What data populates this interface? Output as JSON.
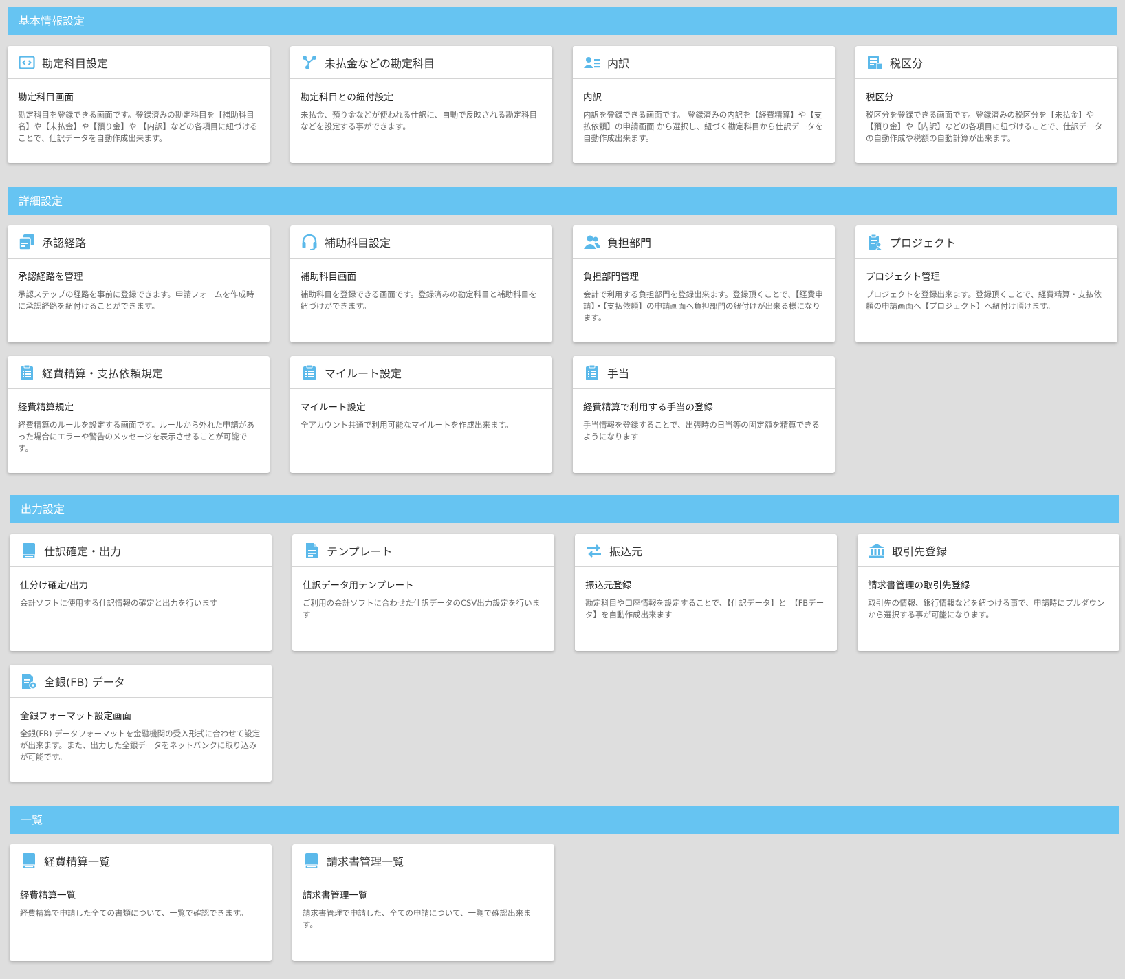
{
  "colors": {
    "accent": "#66c4f2",
    "icon": "#5bb9ea",
    "background": "#dedede"
  },
  "sections": [
    {
      "title": "基本情報設定",
      "cards": [
        {
          "icon": "code-icon",
          "title": "勘定科目設定",
          "subtitle": "勘定科目画面",
          "desc": "勘定科目を登録できる画面です。登録済みの勘定科目を【補助科目名】や【未払金】や【預り金】や 【内訳】などの各項目に紐づけることで、仕訳データを自動作成出来ます。"
        },
        {
          "icon": "link-icon",
          "title": "未払金などの勘定科目",
          "subtitle": "勘定科目との紐付設定",
          "desc": "未払金、預り金などが使われる仕訳に、自動で反映される勘定科目などを設定する事ができます。"
        },
        {
          "icon": "user-list-icon",
          "title": "内訳",
          "subtitle": "内訳",
          "desc": "内訳を登録できる画面です。 登録済みの内訳を【経費精算】や【支払依頼】の申請画面 から選択し、紐づく勘定科目から仕訳データを自動作成出来ます。"
        },
        {
          "icon": "tax-icon",
          "title": "税区分",
          "subtitle": "税区分",
          "desc": "税区分を登録できる画面です。登録済みの税区分を【未払金】や【預り金】や【内訳】などの各項目に紐づけることで、仕訳データの自動作成や税額の自動計算が出来ます。"
        }
      ]
    },
    {
      "title": "詳細設定",
      "cards": [
        {
          "icon": "copy-icon",
          "title": "承認経路",
          "subtitle": "承認経路を管理",
          "desc": "承認ステップの経路を事前に登録できます。申請フォームを作成時に承認経路を紐付けることができます。"
        },
        {
          "icon": "headset-icon",
          "title": "補助科目設定",
          "subtitle": "補助科目画面",
          "desc": "補助科目を登録できる画面です。登録済みの勘定科目と補助科目を紐づけができます。"
        },
        {
          "icon": "users-icon",
          "title": "負担部門",
          "subtitle": "負担部門管理",
          "desc": "会計で利用する負担部門を登録出来ます。登録頂くことで、【経費申請】・【支払依頼】の申請画面へ負担部門の紐付けが出来る様になります。"
        },
        {
          "icon": "clipboard-user-icon",
          "title": "プロジェクト",
          "subtitle": "プロジェクト管理",
          "desc": "プロジェクトを登録出来ます。登録頂くことで、経費精算・支払依頼の申請画面へ【プロジェクト】へ紐付け頂けます。"
        },
        {
          "icon": "checklist-icon",
          "title": "経費精算・支払依頼規定",
          "subtitle": "経費精算規定",
          "desc": "経費精算のルールを設定する画面です。ルールから外れた申請があった場合にエラーや警告のメッセージを表示させることが可能です。"
        },
        {
          "icon": "checklist-icon",
          "title": "マイルート設定",
          "subtitle": "マイルート設定",
          "desc": "全アカウント共通で利用可能なマイルートを作成出来ます。"
        },
        {
          "icon": "checklist-icon",
          "title": "手当",
          "subtitle": "経費精算で利用する手当の登録",
          "desc": "手当情報を登録することで、出張時の日当等の固定額を精算できるようになります"
        }
      ]
    },
    {
      "title": "出力設定",
      "cards": [
        {
          "icon": "book-icon",
          "title": "仕訳確定・出力",
          "subtitle": "仕分け確定/出力",
          "desc": "会計ソフトに使用する仕訳情報の確定と出力を行います"
        },
        {
          "icon": "document-icon",
          "title": "テンプレート",
          "subtitle": "仕訳データ用テンプレート",
          "desc": "ご利用の会計ソフトに合わせた仕訳データのCSV出力設定を行います"
        },
        {
          "icon": "transfer-icon",
          "title": "振込元",
          "subtitle": "振込元登録",
          "desc": "勘定科目や口座情報を設定することで、【仕訳データ】と　【FBデータ】を自動作成出来ます"
        },
        {
          "icon": "bank-icon",
          "title": "取引先登録",
          "subtitle": "請求書管理の取引先登録",
          "desc": "取引先の情報、銀行情報などを紐つける事で、申請時にプルダウンから選択する事が可能になります。"
        },
        {
          "icon": "file-settings-icon",
          "title": "全銀(FB) データ",
          "subtitle": "全銀フォーマット設定画面",
          "desc": "全銀(FB) データフォーマットを金融機関の受入形式に合わせて設定が出来ます。また、出力した全銀データをネットバンクに取り込みが可能です。"
        }
      ]
    },
    {
      "title": "一覧",
      "cards": [
        {
          "icon": "book-icon",
          "title": "経費精算一覧",
          "subtitle": "経費精算一覧",
          "desc": "経費精算で申請した全ての書類について、一覧で確認できます。"
        },
        {
          "icon": "book-icon",
          "title": "請求書管理一覧",
          "subtitle": "請求書管理一覧",
          "desc": "請求書管理で申請した、全ての申請について、一覧で確認出来ます。"
        }
      ]
    }
  ]
}
